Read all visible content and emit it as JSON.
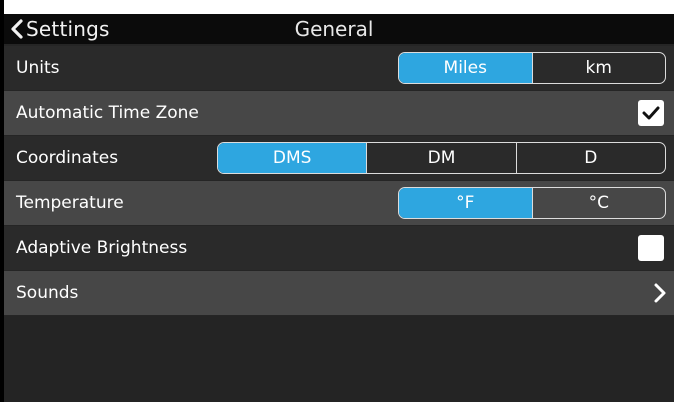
{
  "header": {
    "back_label": "Settings",
    "title": "General"
  },
  "rows": [
    {
      "label": "Units",
      "control": "segmented",
      "options": [
        "Miles",
        "km"
      ],
      "selected": "Miles"
    },
    {
      "label": "Automatic Time Zone",
      "control": "checkbox",
      "checked": true
    },
    {
      "label": "Coordinates",
      "control": "segmented",
      "options": [
        "DMS",
        "DM",
        "D"
      ],
      "selected": "DMS"
    },
    {
      "label": "Temperature",
      "control": "segmented",
      "options": [
        "°F",
        "°C"
      ],
      "selected": "°F"
    },
    {
      "label": "Adaptive Brightness",
      "control": "checkbox",
      "checked": false
    },
    {
      "label": "Sounds",
      "control": "chevron"
    }
  ],
  "colors": {
    "accent": "#2ea6e0",
    "row_dark": "#2a2a2a",
    "row_light": "#474747",
    "header": "#0b0b0b"
  },
  "icons": {
    "back": "chevron-left-icon",
    "check": "checkmark-icon",
    "disclosure": "chevron-right-icon"
  }
}
